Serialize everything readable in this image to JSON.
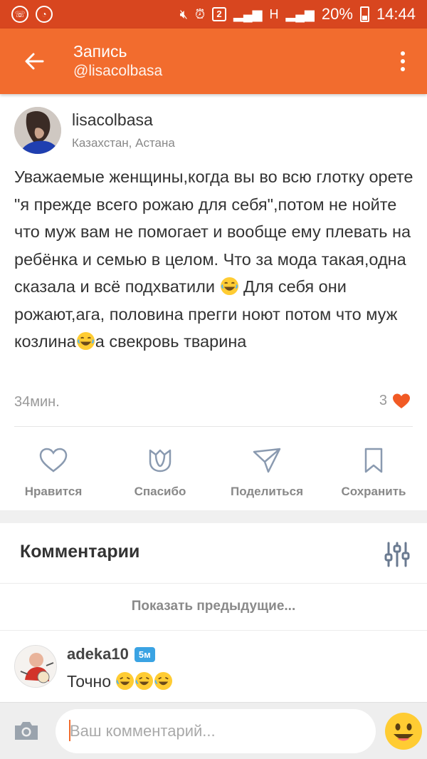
{
  "status_bar": {
    "battery": "20%",
    "time": "14:44",
    "sim_badge": "2",
    "network": "H"
  },
  "header": {
    "title": "Запись",
    "subtitle": "@lisacolbasa"
  },
  "post": {
    "author": "lisacolbasa",
    "location": "Казахстан, Астана",
    "text_part1": "Уважаемые женщины,когда вы во всю глотку орете \"я прежде всего рожаю для себя\",потом не нойте что муж вам не помогает и вообще ему плевать на ребёнка и семью в целом. Что за мода такая,одна сказала и всё подхватили ",
    "text_part2": " Для себя они рожают,ага, половина прегги ноют потом что муж козлина",
    "text_part3": "а свекровь тварина",
    "time": "34мин.",
    "likes_count": "3"
  },
  "actions": {
    "like": "Нравится",
    "thanks": "Спасибо",
    "share": "Поделиться",
    "save": "Сохранить"
  },
  "comments": {
    "title": "Комментарии",
    "show_previous": "Показать предыдущие...",
    "items": [
      {
        "author": "adeka10",
        "badge": "5м",
        "text": "Точно "
      }
    ]
  },
  "input": {
    "placeholder": "Ваш комментарий..."
  },
  "colors": {
    "accent": "#f26c2e",
    "status_bar": "#d8461f",
    "like_heart": "#f15a24"
  }
}
